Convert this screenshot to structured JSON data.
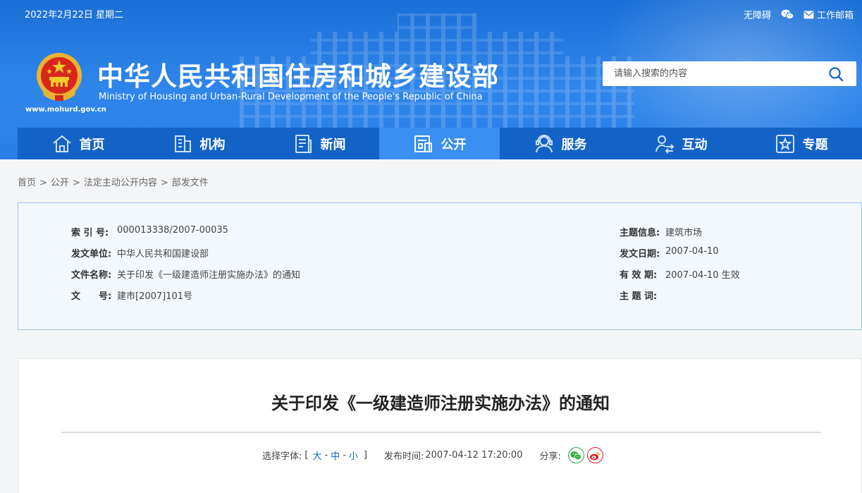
{
  "topbar": {
    "date": "2022年2月22日 星期二",
    "accessibility": "无障碍",
    "email": "工作邮箱"
  },
  "header": {
    "site_url": "www.mohurd.gov.cn",
    "title": "中华人民共和国住房和城乡建设部",
    "subtitle": "Ministry of Housing and Urban-Rural Development of the People's Republic of China"
  },
  "search": {
    "placeholder": "请输入搜索的内容"
  },
  "nav": {
    "tabs": [
      {
        "label": "首页"
      },
      {
        "label": "机构"
      },
      {
        "label": "新闻"
      },
      {
        "label": "公开"
      },
      {
        "label": "服务"
      },
      {
        "label": "互动"
      },
      {
        "label": "专题"
      }
    ],
    "active_index": 3
  },
  "breadcrumb": {
    "items": [
      "首页",
      "公开",
      "法定主动公开内容",
      "部发文件"
    ],
    "separator": ">"
  },
  "info": {
    "index_label": "索 引 号:",
    "index_value": "000013338/2007-00035",
    "issuer_label": "发文单位:",
    "issuer_value": "中华人民共和国建设部",
    "docname_label": "文件名称:",
    "docname_value": "关于印发《一级建造师注册实施办法》的通知",
    "docno_label": "文　　号:",
    "docno_value": "建市[2007]101号",
    "topic_label": "主题信息:",
    "topic_value": "建筑市场",
    "date_label": "发文日期:",
    "date_value": "2007-04-10",
    "validity_label": "有 效 期:",
    "validity_value": "2007-04-10 生效",
    "keywords_label": "主 题 词:",
    "keywords_value": ""
  },
  "article": {
    "title": "关于印发《一级建造师注册实施办法》的通知",
    "font_label": "选择字体:",
    "bracket_open": "[",
    "font_large": "大",
    "font_medium": "中",
    "font_small": "小",
    "dash": "-",
    "bracket_close": "]",
    "publish_label": "发布时间:",
    "publish_time": "2007-04-12 17:20:00",
    "share_label": "分享:"
  },
  "colors": {
    "header_blue": "#2a7fe4",
    "nav_blue": "#1363c7",
    "nav_active": "#3a8ff0",
    "wechat_green": "#2bad38",
    "weibo_red": "#e6162d"
  },
  "icons": [
    "wechat-icon",
    "mail-icon",
    "search-icon",
    "home-icon",
    "building-icon",
    "newspaper-icon",
    "public-docs-icon",
    "service-icon",
    "interaction-icon",
    "topic-star-icon",
    "weibo-icon",
    "national-emblem"
  ]
}
